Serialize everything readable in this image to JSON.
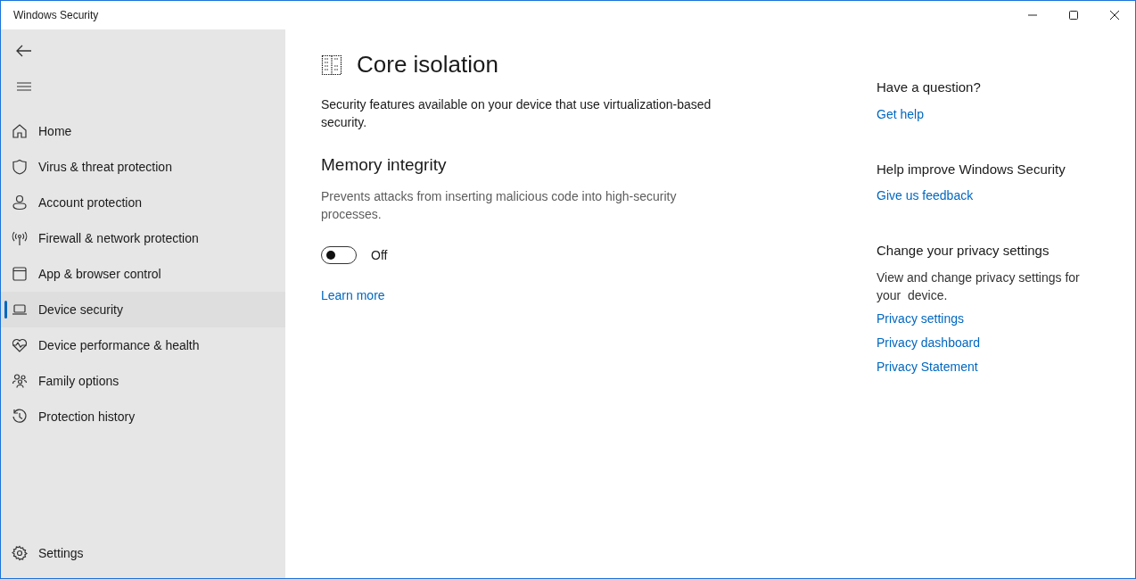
{
  "window": {
    "title": "Windows Security"
  },
  "sidebar": {
    "items": [
      {
        "label": "Home",
        "selected": false
      },
      {
        "label": "Virus & threat protection",
        "selected": false
      },
      {
        "label": "Account protection",
        "selected": false
      },
      {
        "label": "Firewall & network protection",
        "selected": false
      },
      {
        "label": "App & browser control",
        "selected": false
      },
      {
        "label": "Device security",
        "selected": true
      },
      {
        "label": "Device performance & health",
        "selected": false
      },
      {
        "label": "Family options",
        "selected": false
      },
      {
        "label": "Protection history",
        "selected": false
      }
    ],
    "footer": {
      "label": "Settings"
    }
  },
  "main": {
    "title": "Core isolation",
    "description": "Security features available on your device that use virtualization-based security.",
    "section": {
      "title": "Memory integrity",
      "description": "Prevents attacks from inserting malicious code into high-security processes.",
      "toggle": {
        "on": false,
        "label": "Off"
      },
      "link": "Learn more"
    }
  },
  "aside": [
    {
      "heading": "Have a question?",
      "links": [
        "Get help"
      ]
    },
    {
      "heading": "Help improve Windows Security",
      "links": [
        "Give us feedback"
      ]
    },
    {
      "heading": "Change your privacy settings",
      "text": "View and change privacy settings for your  device.",
      "links": [
        "Privacy settings",
        "Privacy dashboard",
        "Privacy Statement"
      ]
    }
  ]
}
